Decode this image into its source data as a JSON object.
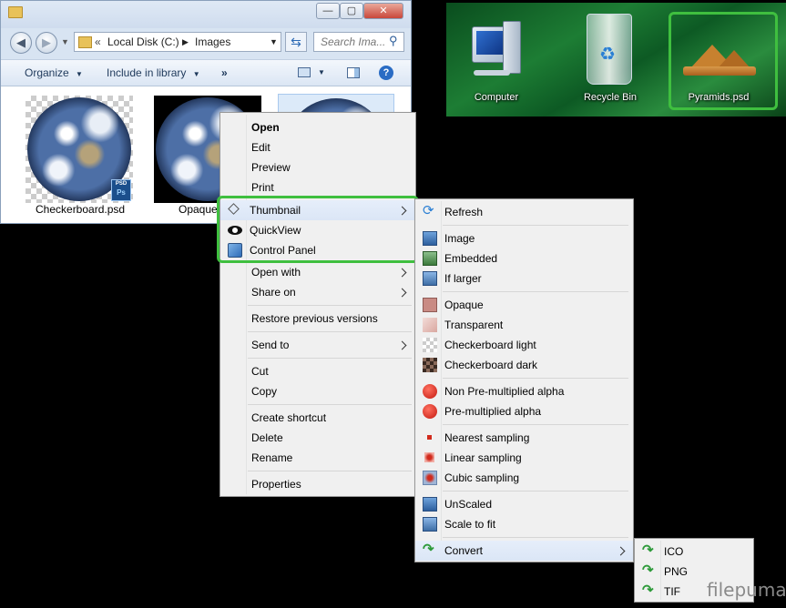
{
  "explorer": {
    "window_buttons": [
      "—",
      "▢",
      "✕"
    ],
    "address": {
      "prefix": "«",
      "segments": [
        "Local Disk (C:)",
        "Images"
      ]
    },
    "search_placeholder": "Search Ima...",
    "toolbar": {
      "organize": "Organize",
      "include": "Include in library",
      "more": "»"
    },
    "files": [
      {
        "name": "Checkerboard.psd",
        "badge": "PSD",
        "badge2": "Ps"
      },
      {
        "name": "Opaque"
      }
    ]
  },
  "desktop": {
    "icons": [
      {
        "label": "Computer"
      },
      {
        "label": "Recycle Bin"
      },
      {
        "label": "Pyramids.psd"
      }
    ]
  },
  "context_menu": {
    "items": [
      {
        "label": "Open",
        "bold": true
      },
      {
        "label": "Edit"
      },
      {
        "label": "Preview"
      },
      {
        "label": "Print"
      },
      {
        "label": "Thumbnail",
        "submenu": true
      },
      {
        "label": "QuickView"
      },
      {
        "label": "Control Panel"
      },
      {
        "label": "Open with",
        "submenu": true
      },
      {
        "label": "Share on",
        "submenu": true
      },
      {
        "label": "Restore previous versions"
      },
      {
        "label": "Send to",
        "submenu": true
      },
      {
        "label": "Cut"
      },
      {
        "label": "Copy"
      },
      {
        "label": "Create shortcut"
      },
      {
        "label": "Delete"
      },
      {
        "label": "Rename"
      },
      {
        "label": "Properties"
      }
    ]
  },
  "thumbnail_menu": {
    "items": [
      {
        "label": "Refresh"
      },
      {
        "label": "Image"
      },
      {
        "label": "Embedded"
      },
      {
        "label": "If larger"
      },
      {
        "label": "Opaque"
      },
      {
        "label": "Transparent"
      },
      {
        "label": "Checkerboard light"
      },
      {
        "label": "Checkerboard dark"
      },
      {
        "label": "Non Pre-multiplied alpha"
      },
      {
        "label": "Pre-multiplied alpha"
      },
      {
        "label": "Nearest sampling"
      },
      {
        "label": "Linear sampling"
      },
      {
        "label": "Cubic sampling"
      },
      {
        "label": "UnScaled"
      },
      {
        "label": "Scale to fit"
      },
      {
        "label": "Convert",
        "submenu": true
      }
    ]
  },
  "convert_menu": {
    "items": [
      {
        "label": "ICO"
      },
      {
        "label": "PNG"
      },
      {
        "label": "TIF"
      }
    ]
  },
  "watermark": "filepuma",
  "colors": {
    "highlight_frame": "#3fbf3f",
    "menu_bg": "#f0f0f0",
    "desktop_green": "#1d7d34"
  }
}
